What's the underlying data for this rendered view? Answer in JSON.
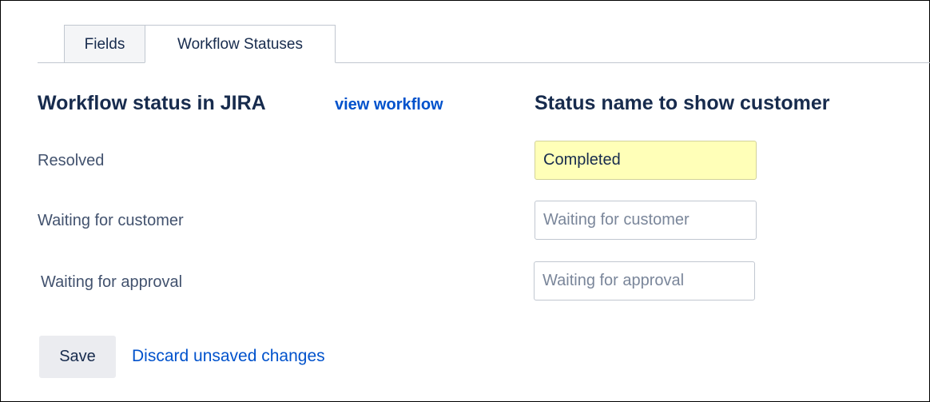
{
  "tabs": [
    {
      "label": "Fields",
      "active": false
    },
    {
      "label": "Workflow Statuses",
      "active": true
    }
  ],
  "headings": {
    "left": "Workflow status in JIRA",
    "view_workflow_link": "view workflow",
    "right": "Status name to show customer"
  },
  "rows": [
    {
      "status": "Resolved",
      "value": "Completed",
      "placeholder": "",
      "highlighted": true
    },
    {
      "status": "Waiting for customer",
      "value": "",
      "placeholder": "Waiting for customer",
      "highlighted": false
    },
    {
      "status": "Waiting for approval",
      "value": "",
      "placeholder": "Waiting for approval",
      "highlighted": false
    }
  ],
  "actions": {
    "save_label": "Save",
    "discard_label": "Discard unsaved changes"
  },
  "colors": {
    "heading": "#172b4d",
    "label": "#42526e",
    "link": "#0052cc",
    "highlight": "#ffffb8",
    "button_bg": "#ebecf0"
  }
}
